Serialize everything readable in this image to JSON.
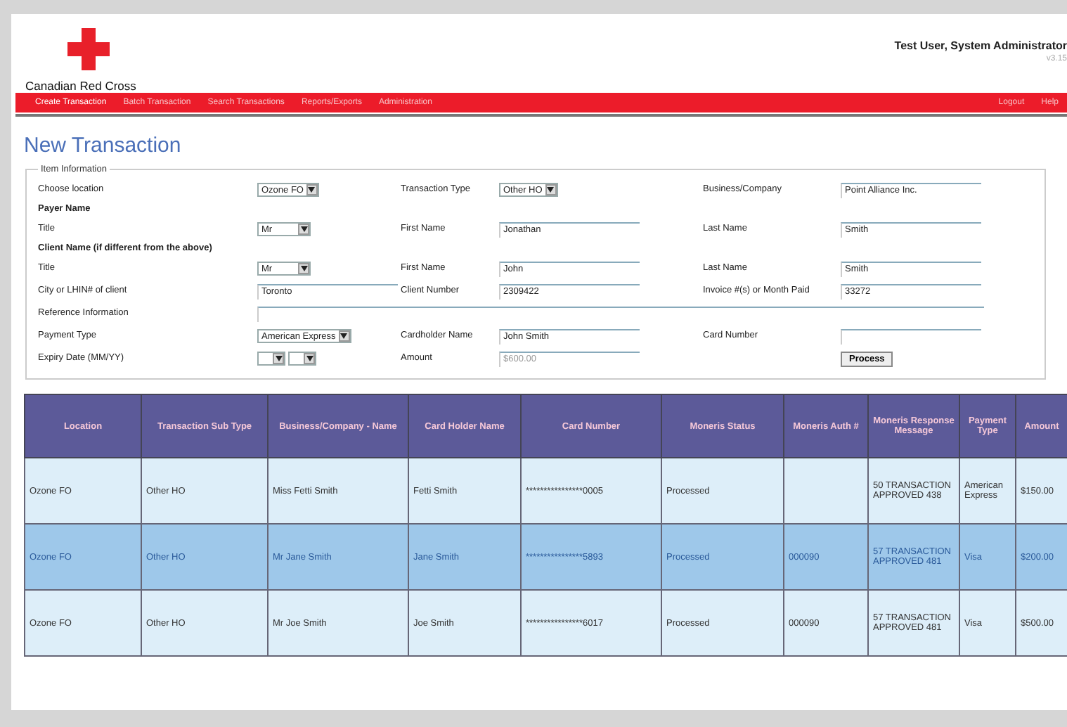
{
  "header": {
    "org_name": "Canadian Red Cross",
    "user": "Test User, System Administrator",
    "version": "v3.15"
  },
  "nav": {
    "left": [
      {
        "label": "Create Transaction",
        "selected": true
      },
      {
        "label": "Batch Transaction",
        "selected": false
      },
      {
        "label": "Search Transactions",
        "selected": false
      },
      {
        "label": "Reports/Exports",
        "selected": false
      },
      {
        "label": "Administration",
        "selected": false
      }
    ],
    "right": [
      "Logout",
      "Help"
    ]
  },
  "page_title": "New Transaction",
  "form": {
    "legend": "Item Information",
    "rows": [
      {
        "kind": "fields",
        "cells": [
          {
            "label": "Choose location",
            "control": {
              "kind": "select",
              "value": "Ozone FO"
            }
          },
          {
            "label": "Transaction Type",
            "control": {
              "kind": "select",
              "value": "Other HO"
            }
          },
          {
            "label": "Business/Company",
            "control": {
              "kind": "text",
              "value": "Point Alliance Inc."
            }
          }
        ]
      },
      {
        "kind": "heading",
        "text": "Payer Name"
      },
      {
        "kind": "fields",
        "cells": [
          {
            "label": "Title",
            "control": {
              "kind": "select",
              "value": "Mr"
            }
          },
          {
            "label": "First Name",
            "control": {
              "kind": "text",
              "value": "Jonathan"
            }
          },
          {
            "label": "Last Name",
            "control": {
              "kind": "text",
              "value": "Smith"
            }
          }
        ]
      },
      {
        "kind": "heading",
        "text": "Client Name (if different from the above)"
      },
      {
        "kind": "fields",
        "cells": [
          {
            "label": "Title",
            "control": {
              "kind": "select",
              "value": "Mr"
            }
          },
          {
            "label": "First Name",
            "control": {
              "kind": "text",
              "value": "John"
            }
          },
          {
            "label": "Last Name",
            "control": {
              "kind": "text",
              "value": "Smith"
            }
          }
        ]
      },
      {
        "kind": "fields",
        "cells": [
          {
            "label": "City or LHIN# of client",
            "control": {
              "kind": "text",
              "value": "Toronto"
            }
          },
          {
            "label": "Client Number",
            "control": {
              "kind": "text",
              "value": "2309422"
            }
          },
          {
            "label": "Invoice #(s) or Month Paid",
            "control": {
              "kind": "text",
              "value": "33272"
            }
          }
        ]
      },
      {
        "kind": "wide",
        "label": "Reference Information"
      },
      {
        "kind": "fields",
        "cells": [
          {
            "label": "Payment Type",
            "control": {
              "kind": "select",
              "value": "American Express"
            }
          },
          {
            "label": "Cardholder Name",
            "control": {
              "kind": "text",
              "value": "John Smith"
            }
          },
          {
            "label": "Card Number",
            "control": {
              "kind": "text"
            }
          }
        ]
      },
      {
        "kind": "fields",
        "cells": [
          {
            "label": "Expiry Date (MM/YY)",
            "control": {
              "kind": "expiry"
            }
          },
          {
            "label": "Amount",
            "control": {
              "kind": "text",
              "value": "$600.00",
              "disabled": true
            }
          },
          {
            "control": {
              "kind": "button",
              "value": "Process"
            }
          }
        ]
      }
    ]
  },
  "table": {
    "columns": [
      "Location",
      "Transaction Sub Type",
      "Business/Company - Name",
      "Card Holder Name",
      "Card Number",
      "Moneris Status",
      "Moneris Auth #",
      "Moneris Response Message",
      "Payment Type",
      "Amount"
    ],
    "rows": [
      {
        "selected": false,
        "cells": [
          "Ozone FO",
          "Other HO",
          "Miss Fetti Smith",
          "Fetti Smith",
          "****************0005",
          "Processed",
          "",
          "50 TRANSACTION APPROVED 438",
          "American Express",
          "$150.00"
        ]
      },
      {
        "selected": true,
        "cells": [
          "Ozone FO",
          "Other HO",
          "Mr Jane Smith",
          "Jane Smith",
          "****************5893",
          "Processed",
          "000090",
          "57 TRANSACTION APPROVED 481",
          "Visa",
          "$200.00"
        ]
      },
      {
        "selected": false,
        "cells": [
          "Ozone FO",
          "Other HO",
          "Mr Joe Smith",
          "Joe Smith",
          "****************6017",
          "Processed",
          "000090",
          "57 TRANSACTION APPROVED 481",
          "Visa",
          "$500.00"
        ]
      }
    ]
  }
}
